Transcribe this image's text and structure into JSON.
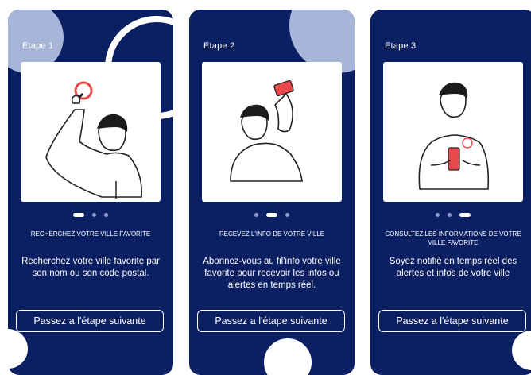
{
  "screens": [
    {
      "step": "Etape 1",
      "caption": "RECHERCHEZ VOTRE VILLE FAVORITE",
      "description": "Recherchez votre ville favorite par son nom ou son code postal.",
      "button": "Passez a l'étape suivante",
      "active_dot": 0
    },
    {
      "step": "Etape 2",
      "caption": "RECEVEZ L'INFO DE VOTRE VILLE",
      "description": "Abonnez-vous au fil'info votre ville favorite pour recevoir les infos ou alertes en temps réel.",
      "button": "Passez a l'étape suivante",
      "active_dot": 1
    },
    {
      "step": "Etape 3",
      "caption": "CONSULTEZ LES INFORMATIONS DE VOTRE VILLE FAVORITE",
      "description": "Soyez notifié en temps réel des alertes et infos de votre ville",
      "button": "Passez a l'étape suivante",
      "active_dot": 2
    }
  ],
  "colors": {
    "card_bg": "#0b1f63",
    "accent_red": "#e8474c",
    "decor_circle": "#a7b6d8"
  },
  "icons": [
    "magnifier-ring-icon",
    "phone-icon",
    "notification-badge-icon"
  ]
}
